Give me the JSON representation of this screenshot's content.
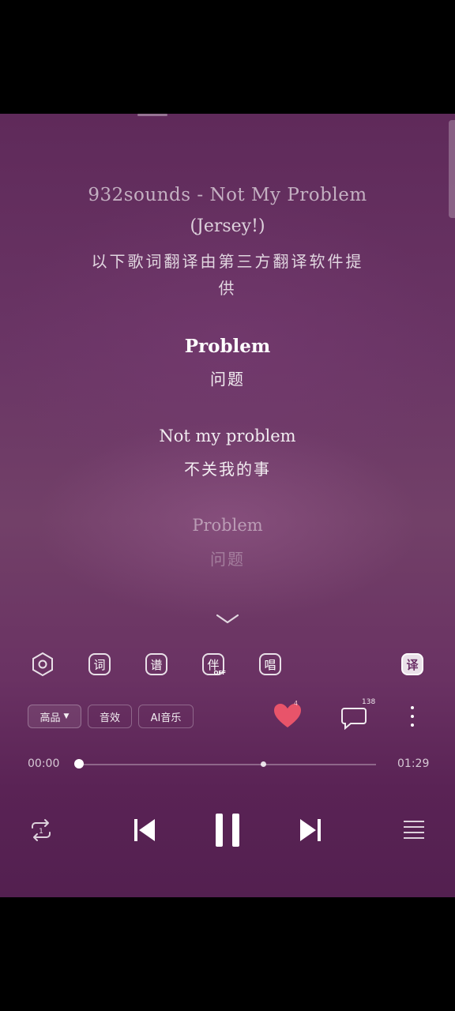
{
  "lyrics": {
    "title_line": "932sounds - Not My Problem",
    "title_line2": "(Jersey!)",
    "translation_note": "以下歌词翻译由第三方翻译软件提供",
    "lines": [
      {
        "original": "Problem",
        "translation": "问题"
      },
      {
        "original": "Not my problem",
        "translation": "不关我的事"
      },
      {
        "original": "Problem",
        "translation": "问题"
      }
    ]
  },
  "toolbar": {
    "lyrics_label": "词",
    "score_label": "谱",
    "accompany_label": "伴",
    "accompany_state": "OFF",
    "sing_label": "唱",
    "translate_label": "译"
  },
  "options": {
    "quality_label": "高品",
    "sound_effect_label": "音效",
    "ai_music_label": "AI音乐"
  },
  "actions": {
    "like_count": "4",
    "comment_count": "138"
  },
  "player": {
    "current_time": "00:00",
    "total_time": "01:29",
    "progress": 0.0,
    "buffered": 0.62,
    "state": "playing"
  },
  "colors": {
    "background_top": "#5f2a5a",
    "background_bottom": "#532050",
    "heart": "#e8546a"
  }
}
